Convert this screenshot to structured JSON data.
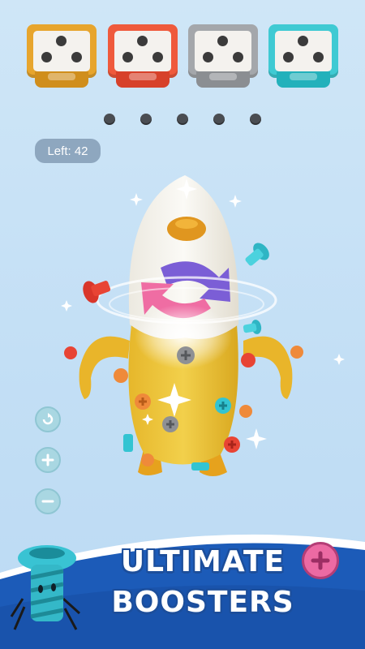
{
  "status": {
    "left_label": "Left: 42"
  },
  "bins": [
    {
      "color": "#e7a52d",
      "base": "#d08e1c"
    },
    {
      "color": "#ef5a3c",
      "base": "#d7412a"
    },
    {
      "color": "#a4a7ab",
      "base": "#8b8e92"
    },
    {
      "color": "#3fcad3",
      "base": "#23b1bb"
    }
  ],
  "tool_buttons": [
    {
      "icon": "undo-icon"
    },
    {
      "icon": "plus-icon"
    },
    {
      "icon": "minus-icon"
    }
  ],
  "banner": {
    "line1": "ULTIMATE",
    "line2": "BOOSTERS",
    "booster_icon": "plus-icon",
    "colors": {
      "banner_bg": "#1c5bb8",
      "booster_pink": "#ec6aa3"
    }
  }
}
